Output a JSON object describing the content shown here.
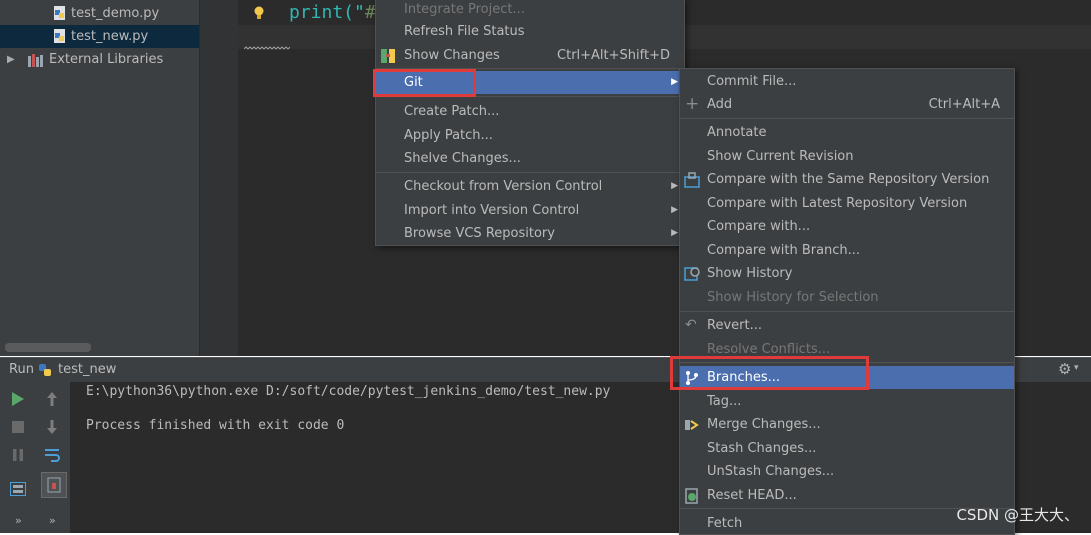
{
  "project_tree": {
    "items": [
      {
        "label": "test_demo.py",
        "selected": false,
        "icon": "python-file-icon"
      },
      {
        "label": "test_new.py",
        "selected": true,
        "icon": "python-file-icon"
      },
      {
        "label": "External Libraries",
        "icon": "library-icon"
      }
    ]
  },
  "editor": {
    "code_fragment": "print(\"",
    "code_cut": "#"
  },
  "run": {
    "title": "Run",
    "config_name": "test_new",
    "console_lines": [
      "E:\\python36\\python.exe D:/soft/code/pytest_jenkins_demo/test_new.py",
      "",
      "Process finished with exit code 0"
    ],
    "settings_icon": "gear-icon"
  },
  "context_menu": {
    "items": [
      {
        "label": "Integrate Project..."
      },
      {
        "label": "Refresh File Status"
      },
      {
        "label": "Show Changes",
        "shortcut": "Ctrl+Alt+Shift+D"
      },
      {
        "label": "Git",
        "submenu": true,
        "selected": true
      },
      {
        "label": "Create Patch..."
      },
      {
        "label": "Apply Patch..."
      },
      {
        "label": "Shelve Changes..."
      },
      {
        "label": "Checkout from Version Control",
        "submenu": true
      },
      {
        "label": "Import into Version Control",
        "submenu": true
      },
      {
        "label": "Browse VCS Repository",
        "submenu": true
      }
    ]
  },
  "git_menu": {
    "items": [
      {
        "label": "Commit File..."
      },
      {
        "label": "Add",
        "shortcut": "Ctrl+Alt+A"
      },
      {
        "label": "Annotate"
      },
      {
        "label": "Show Current Revision"
      },
      {
        "label": "Compare with the Same Repository Version"
      },
      {
        "label": "Compare with Latest Repository Version"
      },
      {
        "label": "Compare with..."
      },
      {
        "label": "Compare with Branch..."
      },
      {
        "label": "Show History"
      },
      {
        "label": "Show History for Selection",
        "disabled": true
      },
      {
        "label": "Revert..."
      },
      {
        "label": "Resolve Conflicts...",
        "disabled": true
      },
      {
        "label": "Branches...",
        "selected": true
      },
      {
        "label": "Tag..."
      },
      {
        "label": "Merge Changes..."
      },
      {
        "label": "Stash Changes..."
      },
      {
        "label": "UnStash Changes..."
      },
      {
        "label": "Reset HEAD..."
      },
      {
        "label": "Fetch"
      }
    ]
  },
  "colors": {
    "panel": "#3c3f41",
    "editor_bg": "#2b2b2b",
    "selection": "#4b6eaf",
    "highlight_box": "#e03b3b"
  },
  "watermark": "CSDN @王大大、"
}
